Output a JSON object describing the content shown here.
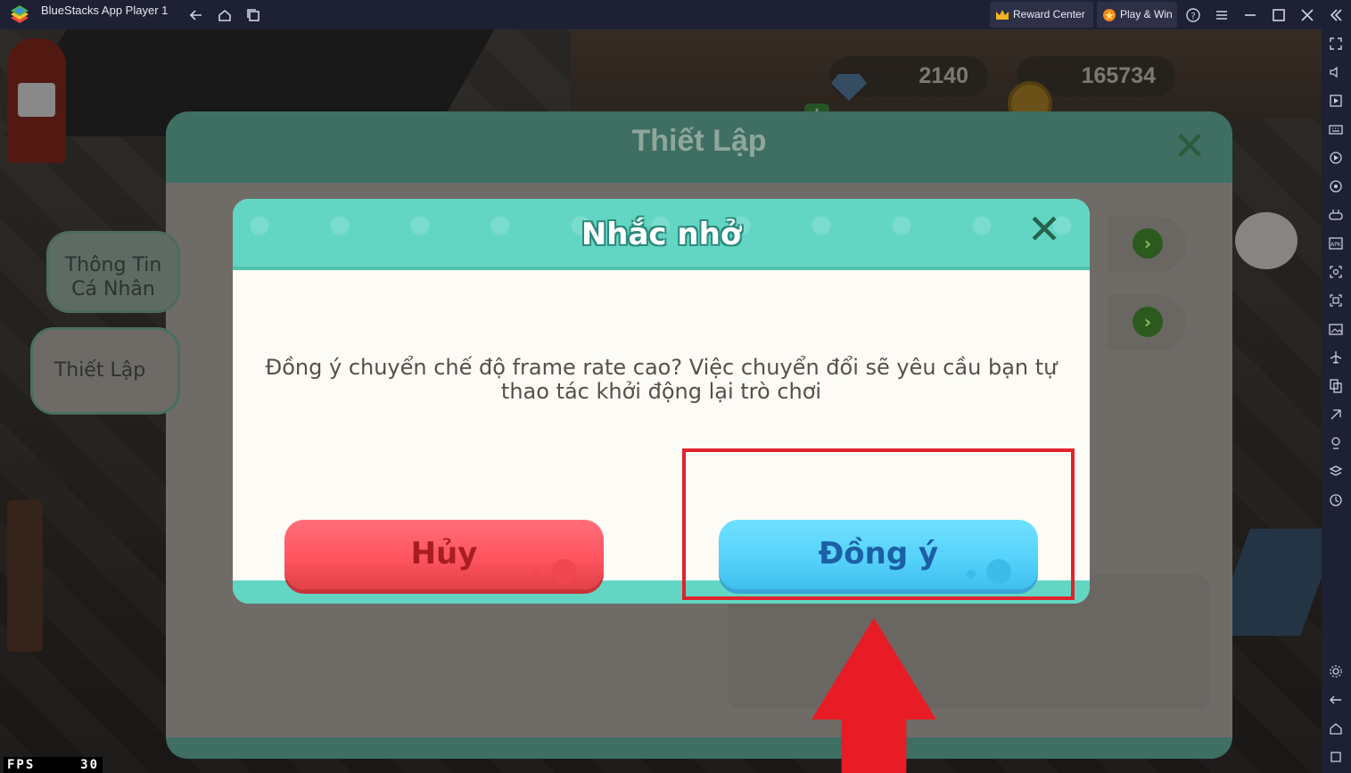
{
  "window": {
    "app_title": "BlueStacks App Player 1",
    "reward_center_label": "Reward Center",
    "play_win_label": "Play & Win"
  },
  "game": {
    "currency": {
      "gems": "2140",
      "coins": "165734"
    },
    "settings_panel": {
      "title": "Thiết Lập",
      "tabs": [
        {
          "label": "Thông Tin\nCá Nhân"
        },
        {
          "label": "Thiết Lập"
        }
      ]
    },
    "dialog": {
      "title": "Nhắc nhở",
      "message": "Đồng ý chuyển chế độ frame rate cao? Việc chuyển đổi sẽ yêu cầu bạn tự thao tác khởi động lại trò chơi",
      "cancel_label": "Hủy",
      "confirm_label": "Đồng ý"
    },
    "fps": {
      "label": "FPS",
      "value": "30"
    }
  },
  "colors": {
    "dialog_header": "#63d6c3",
    "cancel_button": "#ff5560",
    "confirm_button": "#56d2fb",
    "annotation": "#e0232c"
  }
}
